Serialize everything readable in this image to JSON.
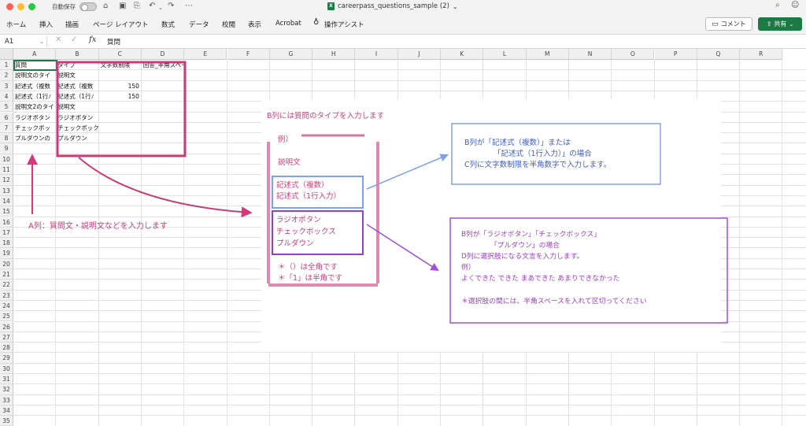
{
  "window": {
    "autosave_label": "自動保存",
    "title": "careerpass_questions_sample (2)",
    "title_chevron": "⌄"
  },
  "ribbon": {
    "tabs": [
      "ホーム",
      "挿入",
      "描画",
      "ページ レイアウト",
      "数式",
      "データ",
      "校閲",
      "表示",
      "Acrobat"
    ],
    "assist_label": "操作アシスト",
    "comment_label": "コメント",
    "share_label": "共有"
  },
  "formula_bar": {
    "name_box": "A1",
    "fx": "fx",
    "value": "質問"
  },
  "sheet": {
    "columns": [
      "A",
      "B",
      "C",
      "D",
      "E",
      "F",
      "G",
      "H",
      "I",
      "J",
      "K",
      "L",
      "M",
      "N",
      "O",
      "P",
      "Q",
      "R"
    ],
    "rows": [
      "1",
      "2",
      "3",
      "4",
      "5",
      "6",
      "7",
      "8",
      "9",
      "10",
      "11",
      "12",
      "13",
      "14",
      "15",
      "16",
      "17",
      "18",
      "19",
      "20",
      "21",
      "22",
      "23",
      "24",
      "25",
      "26",
      "27",
      "28",
      "29",
      "30",
      "31",
      "32",
      "33",
      "34",
      "35"
    ],
    "cells": [
      [
        "質問",
        "タイプ",
        "文字数制限",
        "回答_半角スペース区切り_"
      ],
      [
        "説明文のタイ",
        "説明文",
        "",
        ""
      ],
      [
        "記述式（複数",
        "記述式（複数",
        "150",
        ""
      ],
      [
        "記述式（1行ﾉ",
        "記述式（1行ﾉ",
        "150",
        ""
      ],
      [
        "説明文2のタイ",
        "説明文",
        "",
        ""
      ],
      [
        "ラジオボタン",
        "ラジオボタン",
        "",
        ""
      ],
      [
        "チェックボッ",
        "チェックボックス",
        "",
        ""
      ],
      [
        "プルダウンの",
        "プルダウン",
        "",
        ""
      ]
    ]
  },
  "annotations": {
    "col_a_note": "A列：質問文・説明文などを入力します",
    "col_b_heading": "B列には質問のタイプを入力します",
    "example_label": "例）",
    "type_desc": "説明文",
    "type_text_1": "記述式（複数）",
    "type_text_2": "記述式（1行入力）",
    "type_choice_1": "ラジオボタン",
    "type_choice_2": "チェックボックス",
    "type_choice_3": "プルダウン",
    "width_note_1": "＊（）は全角です",
    "width_note_2": "＊「1」は半角です",
    "blue_note_1": "B列が「記述式（複数）」または",
    "blue_note_2": "「記述式（1行入力）」の場合",
    "blue_note_3": "C列に文字数制限を半角数字で入力します。",
    "purple_note_1": "B列が「ラジオボタン」「チェックボックス」",
    "purple_note_2": "「プルダウン」の場合",
    "purple_note_3": "D列に選択肢になる文言を入力します。",
    "purple_note_4": "例）",
    "purple_note_5": "よくできた できた まあできた あまりできなかった",
    "purple_note_6": "＊選択肢の間には、半角スペースを入れて区切ってください"
  },
  "colors": {
    "pink": "#d23a7a",
    "blue": "#7fa2e6",
    "purple": "#a24fd6",
    "excel_green": "#1d7a45"
  }
}
